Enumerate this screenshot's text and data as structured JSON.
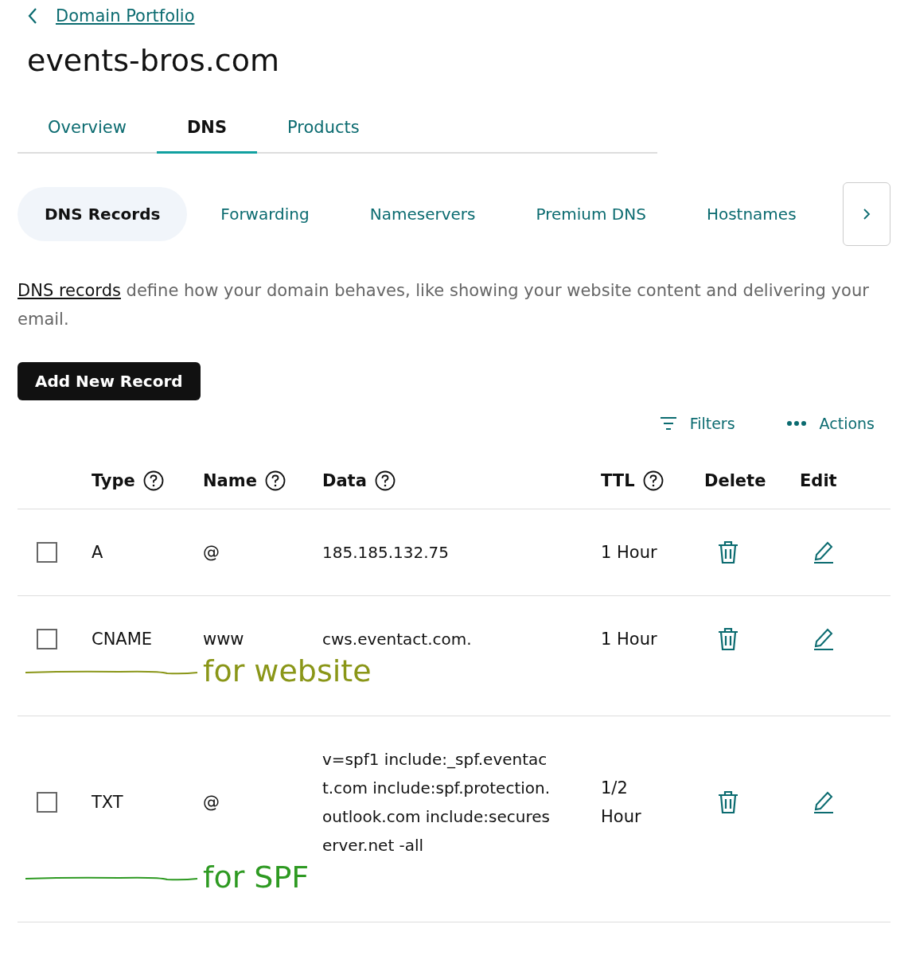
{
  "breadcrumb": {
    "label": "Domain Portfolio"
  },
  "title": "events-bros.com",
  "tabs": [
    {
      "label": "Overview",
      "selected": false
    },
    {
      "label": "DNS",
      "selected": true
    },
    {
      "label": "Products",
      "selected": false
    }
  ],
  "subtabs": [
    {
      "label": "DNS Records",
      "selected": true
    },
    {
      "label": "Forwarding",
      "selected": false
    },
    {
      "label": "Nameservers",
      "selected": false
    },
    {
      "label": "Premium DNS",
      "selected": false
    },
    {
      "label": "Hostnames",
      "selected": false
    }
  ],
  "intro": {
    "link": "DNS records",
    "text": " define how your domain behaves, like showing your website content and delivering your email."
  },
  "add_button": "Add New Record",
  "toolbar": {
    "filters": "Filters",
    "actions": "Actions"
  },
  "table": {
    "columns": [
      {
        "label": "Type",
        "help": true
      },
      {
        "label": "Name",
        "help": true
      },
      {
        "label": "Data",
        "help": true
      },
      {
        "label": "TTL",
        "help": true
      },
      {
        "label": "Delete",
        "help": false
      },
      {
        "label": "Edit",
        "help": false
      }
    ],
    "rows": [
      {
        "checked": false,
        "type": "A",
        "name": "@",
        "data": "185.185.132.75",
        "ttl": "1 Hour"
      },
      {
        "checked": false,
        "type": "CNAME",
        "name": "www",
        "data": "cws.eventact.com.",
        "ttl": "1 Hour",
        "annotation": {
          "text": "for website",
          "color": "#8a9618"
        }
      },
      {
        "checked": false,
        "type": "TXT",
        "name": "@",
        "data": "v=spf1 include:_spf.eventact.com include:spf.protection.outlook.com include:secureserver.net -all",
        "ttl": "1/2 Hour",
        "annotation": {
          "text": "for SPF",
          "color": "#2e9a22"
        }
      }
    ]
  }
}
